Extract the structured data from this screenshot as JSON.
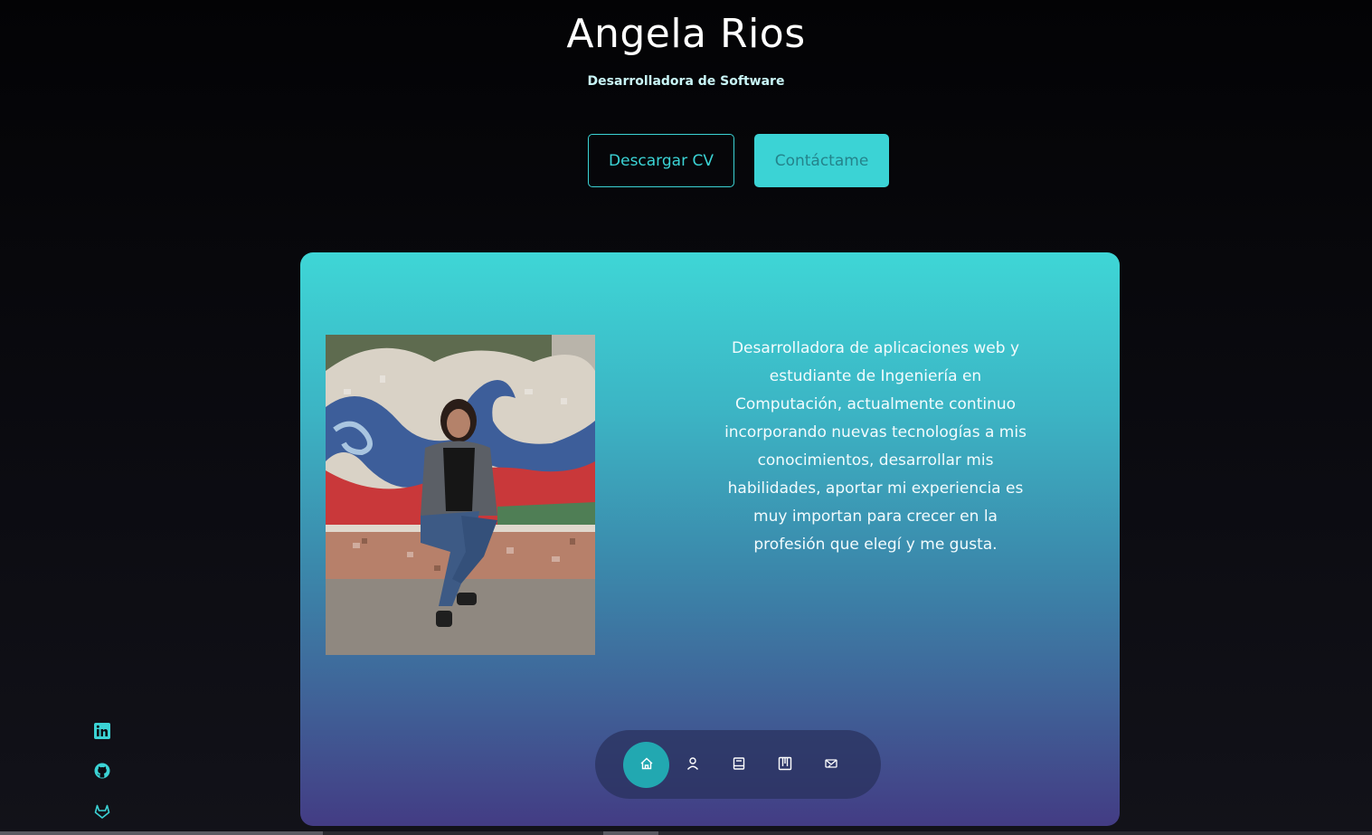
{
  "hero": {
    "name": "Angela Rios",
    "role": "Desarrolladora de Software"
  },
  "buttons": {
    "download_cv": "Descargar CV",
    "contact": "Contáctame"
  },
  "about": {
    "text": "Desarrolladora de aplicaciones web y estudiante de Ingeniería en Computación, actualmente continuo incorporando nuevas tecnologías a mis conocimientos, desarrollar mis habilidades, aportar mi experiencia es muy importan para crecer en la profesión que elegí y me gusta."
  },
  "nav": {
    "items": [
      {
        "icon": "home-icon",
        "active": true
      },
      {
        "icon": "user-icon",
        "active": false
      },
      {
        "icon": "book-icon",
        "active": false
      },
      {
        "icon": "portfolio-icon",
        "active": false
      },
      {
        "icon": "message-icon",
        "active": false
      }
    ]
  },
  "social": {
    "items": [
      {
        "icon": "linkedin-icon"
      },
      {
        "icon": "github-icon"
      },
      {
        "icon": "gitlab-icon"
      }
    ]
  },
  "colors": {
    "accent": "#3bd3d5",
    "nav_active": "#22a8b1",
    "card_top": "#3ed6d6",
    "card_bottom": "#433c84"
  }
}
